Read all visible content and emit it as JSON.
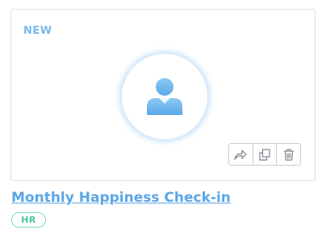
{
  "card": {
    "badge": "NEW",
    "avatar_icon": "user-avatar-icon",
    "actions": [
      {
        "name": "share",
        "icon": "share-icon"
      },
      {
        "name": "duplicate",
        "icon": "copy-icon"
      },
      {
        "name": "delete",
        "icon": "trash-icon"
      }
    ]
  },
  "title": "Monthly Happiness Check-in",
  "tag": "HR",
  "colors": {
    "accent": "#5aa6e6",
    "badge": "#79b9e8",
    "tag": "#4cc5a2"
  }
}
